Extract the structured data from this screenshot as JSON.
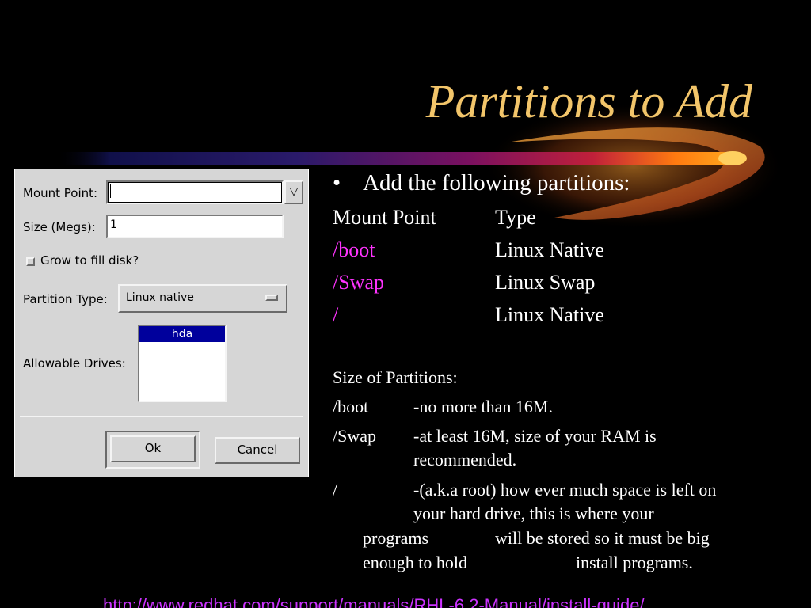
{
  "slide": {
    "title": "Partitions to Add",
    "colors": {
      "background": "#000000",
      "title": "#f2c56a",
      "body_text": "#ffffff",
      "mount_highlight": "#ff33ff",
      "url": "#cc33ff"
    }
  },
  "dialog": {
    "mount_point_label": "Mount Point:",
    "mount_point_value": "",
    "mount_point_dropdown_glyph": "▽",
    "size_label": "Size (Megs):",
    "size_value": "1",
    "grow_label": "Grow to fill disk?",
    "grow_checked": false,
    "partition_type_label": "Partition Type:",
    "partition_type_value": "Linux native",
    "allowable_drives_label": "Allowable Drives:",
    "drives": [
      "hda"
    ],
    "selected_drive": "hda",
    "ok_label": "Ok",
    "cancel_label": "Cancel"
  },
  "content": {
    "bullet": "Add the following partitions:",
    "table_header": {
      "mount": "Mount Point",
      "type": "Type"
    },
    "partitions": [
      {
        "mount": "/boot",
        "type": "Linux Native"
      },
      {
        "mount": "/Swap",
        "type": "Linux Swap"
      },
      {
        "mount": "/",
        "type": "Linux Native"
      }
    ],
    "sizes_heading": "Size of Partitions:",
    "sizes": [
      {
        "mount": "/boot",
        "lines": [
          "-no more than 16M."
        ]
      },
      {
        "mount": "/Swap",
        "lines": [
          "-at least 16M, size of your RAM is",
          "recommended."
        ]
      },
      {
        "mount": "/",
        "lines": [
          "-(a.k.a root) how ever much space is left on",
          "your hard drive, this is where your"
        ]
      }
    ],
    "root_continuation": [
      {
        "left": "programs",
        "right": "will be stored so it  must be big"
      },
      {
        "left": "enough to hold",
        "right": "install programs."
      }
    ]
  },
  "footer": {
    "url": "http://www.redhat.com/support/manuals/RHL-6.2-Manual/install-guide/"
  }
}
